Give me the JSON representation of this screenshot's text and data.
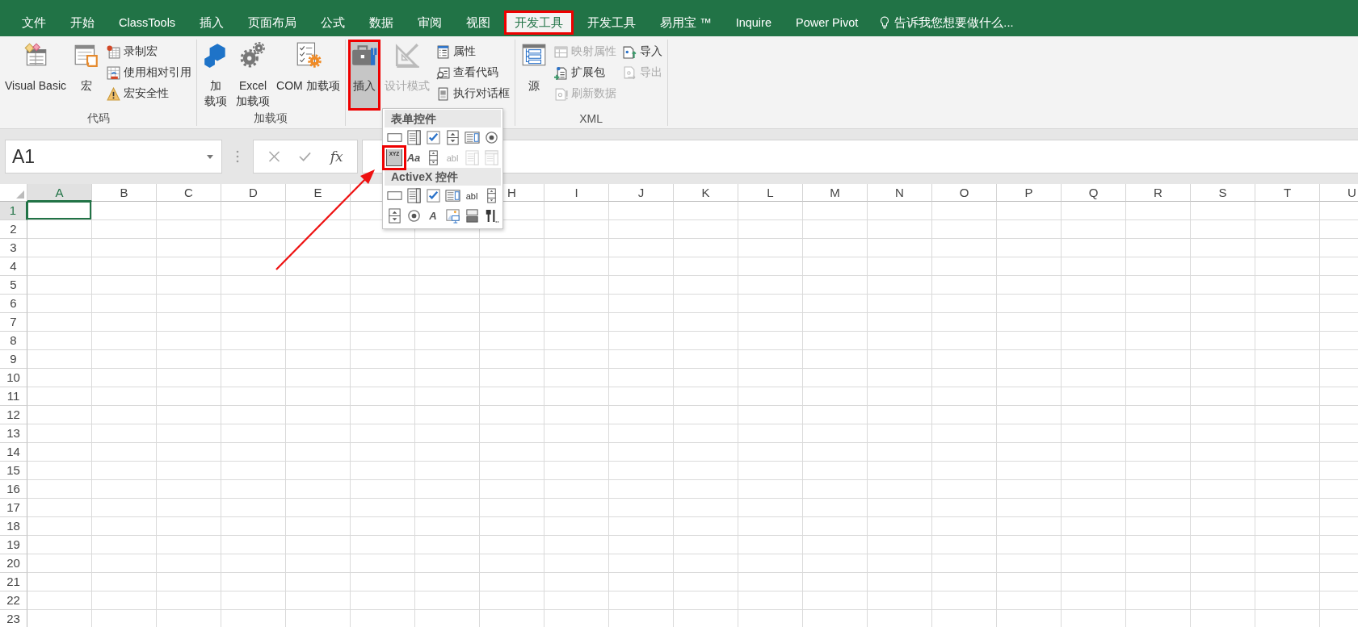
{
  "tabs": [
    {
      "label": "文件",
      "selected": false
    },
    {
      "label": "开始",
      "selected": false
    },
    {
      "label": "ClassTools",
      "selected": false
    },
    {
      "label": "插入",
      "selected": false
    },
    {
      "label": "页面布局",
      "selected": false
    },
    {
      "label": "公式",
      "selected": false
    },
    {
      "label": "数据",
      "selected": false
    },
    {
      "label": "审阅",
      "selected": false
    },
    {
      "label": "视图",
      "selected": false
    },
    {
      "label": "开发工具",
      "selected": true,
      "highlighted": true
    },
    {
      "label": "开发工具",
      "selected": false
    },
    {
      "label": "易用宝 ™",
      "selected": false
    },
    {
      "label": "Inquire",
      "selected": false
    },
    {
      "label": "Power Pivot",
      "selected": false
    }
  ],
  "tell_me": {
    "text": "告诉我您想要做什么..."
  },
  "ribbon": {
    "groups": [
      {
        "label": "代码",
        "items": [
          {
            "kind": "large",
            "label": "Visual Basic",
            "disabled": false,
            "pressed": false
          },
          {
            "kind": "large",
            "label": "宏",
            "disabled": false,
            "pressed": false
          },
          {
            "kind": "small",
            "label": "录制宏",
            "disabled": false,
            "pressed": false
          },
          {
            "kind": "small",
            "label": "使用相对引用",
            "disabled": false,
            "pressed": false
          },
          {
            "kind": "small",
            "label": "宏安全性",
            "disabled": false,
            "pressed": false
          }
        ]
      },
      {
        "label": "加载项",
        "items": [
          {
            "kind": "large",
            "lines": [
              "加",
              "载项"
            ],
            "disabled": false,
            "pressed": false
          },
          {
            "kind": "large",
            "lines": [
              "Excel",
              "加载项"
            ],
            "disabled": false,
            "pressed": false
          },
          {
            "kind": "large",
            "label": "COM 加载项",
            "disabled": false,
            "pressed": false
          }
        ]
      },
      {
        "items": [
          {
            "kind": "large",
            "label": "插入",
            "disabled": false,
            "pressed": true,
            "highlighted": true
          },
          {
            "kind": "large",
            "label": "设计模式",
            "disabled": true,
            "pressed": false
          },
          {
            "kind": "small",
            "label": "属性",
            "disabled": false,
            "pressed": false
          },
          {
            "kind": "small",
            "label": "查看代码",
            "disabled": false,
            "pressed": false
          },
          {
            "kind": "small",
            "label": "执行对话框",
            "disabled": false,
            "pressed": false
          }
        ]
      },
      {
        "label": "XML",
        "items": [
          {
            "kind": "large",
            "label": "源",
            "disabled": false,
            "pressed": false
          },
          {
            "kind": "small",
            "label": "映射属性",
            "disabled": true,
            "pressed": false
          },
          {
            "kind": "small",
            "label": "扩展包",
            "disabled": false,
            "pressed": false
          },
          {
            "kind": "small",
            "label": "刷新数据",
            "disabled": true,
            "pressed": false
          },
          {
            "kind": "small",
            "label": "导入",
            "disabled": false,
            "pressed": false
          },
          {
            "kind": "small",
            "label": "导出",
            "disabled": true,
            "pressed": false
          }
        ]
      }
    ]
  },
  "name_box": {
    "value": "A1"
  },
  "formula_bar": {
    "function_label": "fx"
  },
  "grid": {
    "columns": [
      {
        "label": "A",
        "selected": true
      },
      {
        "label": "B",
        "selected": false
      },
      {
        "label": "C",
        "selected": false
      },
      {
        "label": "D",
        "selected": false
      },
      {
        "label": "E",
        "selected": false
      },
      {
        "selected": false
      },
      {},
      {
        "label": "H",
        "selected": false
      },
      {
        "label": "I",
        "selected": false
      },
      {
        "label": "J",
        "selected": false
      },
      {
        "label": "K",
        "selected": false
      },
      {
        "label": "L",
        "selected": false
      },
      {
        "label": "M",
        "selected": false
      },
      {
        "label": "N",
        "selected": false
      },
      {
        "label": "O",
        "selected": false
      },
      {
        "label": "P",
        "selected": false
      },
      {
        "label": "Q",
        "selected": false
      },
      {
        "label": "R",
        "selected": false
      },
      {
        "label": "S",
        "selected": false
      },
      {
        "label": "T",
        "selected": false
      },
      {
        "label": "U",
        "selected": false
      }
    ],
    "rows": [
      {
        "label": "1",
        "selected": true
      },
      {
        "label": "2",
        "selected": false
      },
      {
        "label": "3",
        "selected": false
      },
      {
        "label": "4",
        "selected": false
      },
      {
        "label": "5",
        "selected": false
      },
      {
        "label": "6",
        "selected": false
      },
      {
        "label": "7",
        "selected": false
      },
      {
        "label": "8",
        "selected": false
      },
      {
        "label": "9",
        "selected": false
      },
      {
        "label": "10",
        "selected": false
      },
      {
        "label": "11",
        "selected": false
      },
      {
        "label": "12",
        "selected": false
      },
      {
        "label": "13",
        "selected": false
      },
      {
        "label": "14",
        "selected": false
      },
      {
        "label": "15",
        "selected": false
      },
      {
        "label": "16",
        "selected": false
      },
      {
        "label": "17",
        "selected": false
      },
      {
        "label": "18",
        "selected": false
      },
      {
        "label": "19",
        "selected": false
      },
      {
        "label": "20",
        "selected": false
      },
      {
        "label": "21",
        "selected": false
      },
      {
        "label": "22",
        "selected": false
      },
      {
        "label": "23",
        "selected": false
      }
    ]
  },
  "insert_menu": {
    "sections": [
      {
        "title": "表单控件",
        "items": [
          {
            "kind": "button",
            "disabled": false
          },
          {
            "kind": "combo-box",
            "disabled": false
          },
          {
            "kind": "check-box",
            "disabled": false
          },
          {
            "kind": "spin-button",
            "disabled": false
          },
          {
            "kind": "list-box",
            "disabled": false
          },
          {
            "kind": "option-button",
            "disabled": false
          },
          {
            "kind": "group-box",
            "glyph": "XYZ",
            "disabled": false,
            "highlighted": true
          },
          {
            "kind": "label",
            "glyph": "Aa",
            "disabled": false
          },
          {
            "kind": "scroll-bar",
            "disabled": false
          },
          {
            "kind": "text-field",
            "glyph": "abl",
            "disabled": true
          },
          {
            "kind": "combo-list",
            "disabled": true
          },
          {
            "kind": "combo-dropdown",
            "disabled": true
          }
        ]
      },
      {
        "title": "ActiveX 控件",
        "items": [
          {
            "kind": "button",
            "disabled": false
          },
          {
            "kind": "combo-box",
            "disabled": false
          },
          {
            "kind": "check-box",
            "disabled": false
          },
          {
            "kind": "list-box",
            "disabled": false
          },
          {
            "kind": "text-field",
            "glyph": "abl",
            "disabled": false
          },
          {
            "kind": "scroll-bar",
            "disabled": false
          },
          {
            "kind": "spin-button",
            "disabled": false
          },
          {
            "kind": "option-button",
            "disabled": false
          },
          {
            "kind": "label",
            "glyph": "A",
            "disabled": false
          },
          {
            "kind": "image",
            "disabled": false
          },
          {
            "kind": "toggle-button",
            "disabled": false
          },
          {
            "kind": "more-controls",
            "disabled": false
          }
        ]
      }
    ]
  }
}
